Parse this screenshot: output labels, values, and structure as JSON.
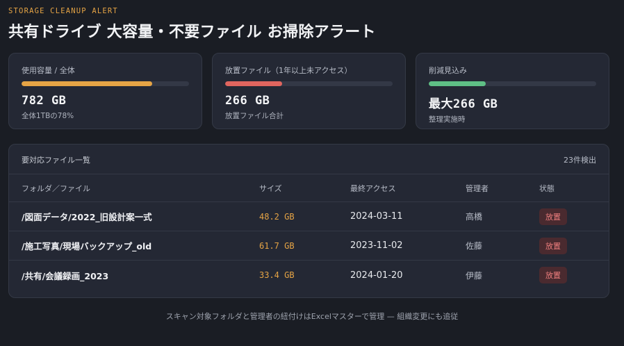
{
  "header": {
    "eyebrow": "STORAGE CLEANUP ALERT",
    "title": "共有ドライブ 大容量・不要ファイル お掃除アラート"
  },
  "cards": [
    {
      "label": "使用容量 / 全体",
      "value": "782 GB",
      "sub": "全体1TBの78%",
      "progress": 0.78,
      "color": "#e6a445"
    },
    {
      "label": "放置ファイル（1年以上未アクセス）",
      "value": "266 GB",
      "sub": "放置ファイル合計",
      "progress": 0.34,
      "color": "#e0655e"
    },
    {
      "label": "削減見込み",
      "value": "最大266 GB",
      "sub": "整理実施時",
      "progress": 0.34,
      "color": "#5fbf85"
    }
  ],
  "table": {
    "title": "要対応ファイル一覧",
    "count": "23件検出",
    "columns": [
      "フォルダ／ファイル",
      "サイズ",
      "最終アクセス",
      "管理者",
      "状態"
    ],
    "rows": [
      {
        "path": "/図面データ/2022_旧設計案一式",
        "size": "48.2 GB",
        "last_access": "2024-03-11",
        "owner": "高橋",
        "status": "放置"
      },
      {
        "path": "/施工写真/現場バックアップ_old",
        "size": "61.7 GB",
        "last_access": "2023-11-02",
        "owner": "佐藤",
        "status": "放置"
      },
      {
        "path": "/共有/会議録画_2023",
        "size": "33.4 GB",
        "last_access": "2024-01-20",
        "owner": "伊藤",
        "status": "放置"
      }
    ]
  },
  "footer": "スキャン対象フォルダと管理者の紐付けはExcelマスターで管理 — 組織変更にも追従"
}
